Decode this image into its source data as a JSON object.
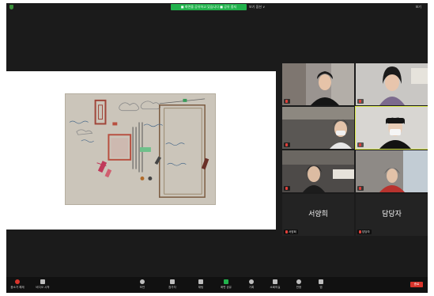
{
  "topbar": {
    "share_banner": "■ 화면을 공유하고 있습니다 ■ 공유 중지",
    "view_options": "보기 옵션 ∨",
    "view_toggle": "보기"
  },
  "share": {
    "top_text": "",
    "bottom_left": "",
    "bottom_right": ""
  },
  "participants": [
    {
      "name": "",
      "type": "video"
    },
    {
      "name": "",
      "type": "video"
    },
    {
      "name": "",
      "type": "video"
    },
    {
      "name": "",
      "type": "video"
    },
    {
      "name": "",
      "type": "video"
    },
    {
      "name": "",
      "type": "video"
    },
    {
      "name": "서양희",
      "type": "name_only",
      "tag": "서양희"
    },
    {
      "name": "담당자",
      "type": "name_only",
      "tag": "담당자"
    }
  ],
  "toolbar": {
    "mute_label": "음소거 해제",
    "video_label": "비디오 시작",
    "security_label": "보안",
    "participants_label": "참가자",
    "chat_label": "채팅",
    "share_label": "화면 공유",
    "record_label": "기록",
    "rooms_label": "소회의실",
    "reactions_label": "반응",
    "apps_label": "앱",
    "end_label": "종료"
  },
  "colors": {
    "share_banner": "#22b24c",
    "end_button": "#d9342b",
    "active_speaker_outline": "#d9e84a"
  }
}
